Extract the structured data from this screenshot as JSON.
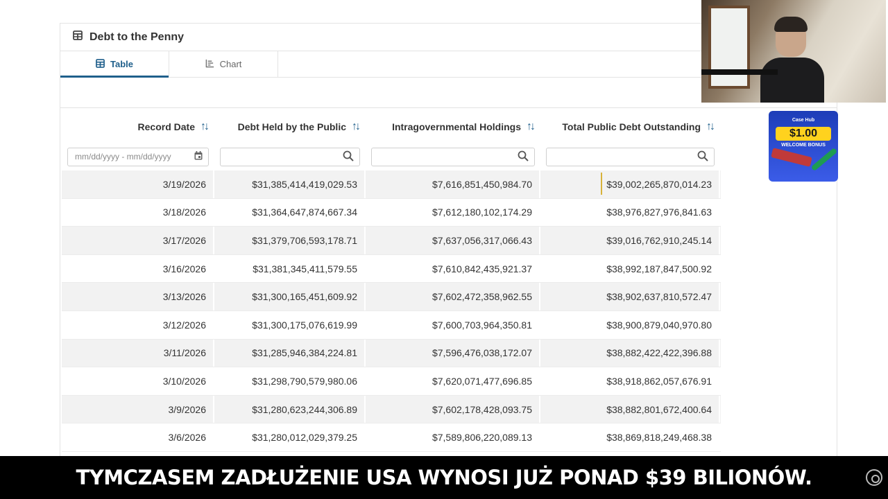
{
  "panel": {
    "title": "Debt to the Penny",
    "tabs": [
      {
        "label": "Table",
        "active": true,
        "icon": "table-icon"
      },
      {
        "label": "Chart",
        "active": false,
        "icon": "chart-icon"
      }
    ]
  },
  "table": {
    "columns": [
      "Record Date",
      "Debt Held by the Public",
      "Intragovernmental Holdings",
      "Total Public Debt Outstanding"
    ],
    "date_filter_placeholder": "mm/dd/yyyy - mm/dd/yyyy",
    "rows": [
      [
        "3/19/2026",
        "$31,385,414,419,029.53",
        "$7,616,851,450,984.70",
        "$39,002,265,870,014.23"
      ],
      [
        "3/18/2026",
        "$31,364,647,874,667.34",
        "$7,612,180,102,174.29",
        "$38,976,827,976,841.63"
      ],
      [
        "3/17/2026",
        "$31,379,706,593,178.71",
        "$7,637,056,317,066.43",
        "$39,016,762,910,245.14"
      ],
      [
        "3/16/2026",
        "$31,381,345,411,579.55",
        "$7,610,842,435,921.37",
        "$38,992,187,847,500.92"
      ],
      [
        "3/13/2026",
        "$31,300,165,451,609.92",
        "$7,602,472,358,962.55",
        "$38,902,637,810,572.47"
      ],
      [
        "3/12/2026",
        "$31,300,175,076,619.99",
        "$7,600,703,964,350.81",
        "$38,900,879,040,970.80"
      ],
      [
        "3/11/2026",
        "$31,285,946,384,224.81",
        "$7,596,476,038,172.07",
        "$38,882,422,422,396.88"
      ],
      [
        "3/10/2026",
        "$31,298,790,579,980.06",
        "$7,620,071,477,696.85",
        "$38,918,862,057,676.91"
      ],
      [
        "3/9/2026",
        "$31,280,623,244,306.89",
        "$7,602,178,428,093.75",
        "$38,882,801,672,400.64"
      ],
      [
        "3/6/2026",
        "$31,280,012,029,379.25",
        "$7,589,806,220,089.13",
        "$38,869,818,249,468.38"
      ]
    ]
  },
  "promo": {
    "brand": "Case Hub",
    "amount": "$1.00",
    "subtitle": "WELCOME BONUS"
  },
  "caption": {
    "text": "TYMCZASEM ZADŁUŻENIE USA WYNOSI JUŻ PONAD $39 BILIONÓW."
  },
  "colors": {
    "accent": "#1f5f8b",
    "stripe": "#f2f2f2",
    "caption_bg": "#000000"
  }
}
